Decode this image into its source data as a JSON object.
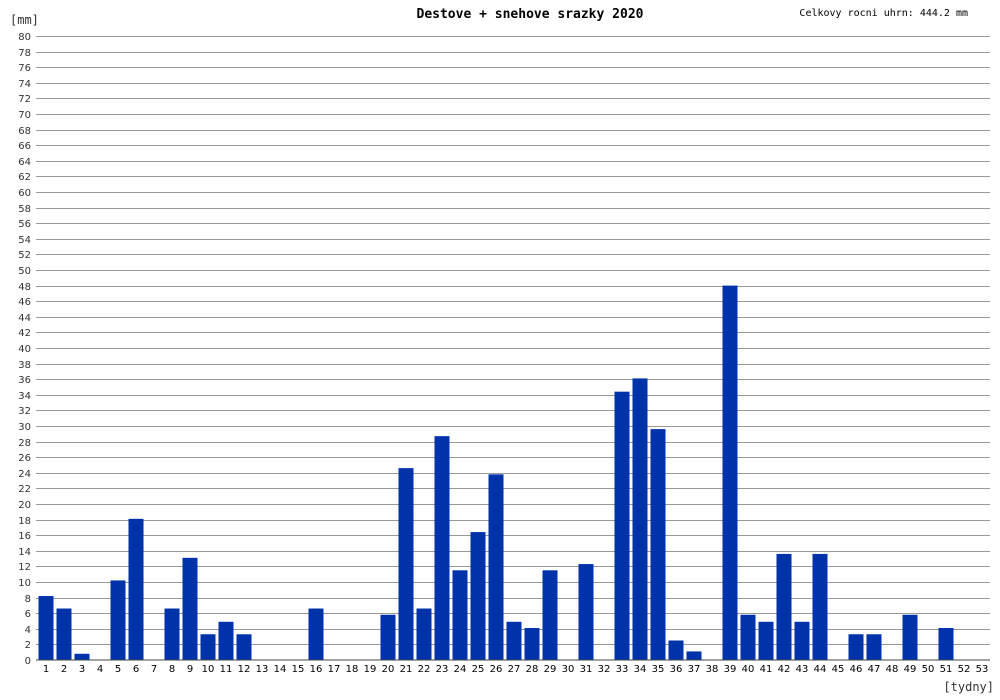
{
  "chart_data": {
    "type": "bar",
    "title": "Destove + snehove srazky 2020",
    "annotation": "Celkovy rocni uhrn: 444.2 mm",
    "ylabel": "[mm]",
    "xlabel": "[tydny]",
    "ylim": [
      0,
      80
    ],
    "ytick_step": 2,
    "grid": true,
    "bar_color": "#0033aa",
    "categories": [
      "1",
      "2",
      "3",
      "4",
      "5",
      "6",
      "7",
      "8",
      "9",
      "10",
      "11",
      "12",
      "13",
      "14",
      "15",
      "16",
      "17",
      "18",
      "19",
      "20",
      "21",
      "22",
      "23",
      "24",
      "25",
      "26",
      "27",
      "28",
      "29",
      "30",
      "31",
      "32",
      "33",
      "34",
      "35",
      "36",
      "37",
      "38",
      "39",
      "40",
      "41",
      "42",
      "43",
      "44",
      "45",
      "46",
      "47",
      "48",
      "49",
      "50",
      "51",
      "52",
      "53"
    ],
    "values": [
      8.2,
      6.6,
      0.8,
      0,
      10.2,
      18.1,
      0,
      6.6,
      13.1,
      3.3,
      4.9,
      3.3,
      0,
      0,
      0,
      6.6,
      0,
      0,
      0,
      5.8,
      24.6,
      6.6,
      28.7,
      11.5,
      16.4,
      23.8,
      4.9,
      4.1,
      11.5,
      0,
      12.3,
      0,
      34.4,
      36.1,
      29.6,
      2.5,
      1.1,
      0,
      48.0,
      5.8,
      4.9,
      13.6,
      4.9,
      13.6,
      0,
      3.3,
      3.3,
      0,
      5.8,
      0,
      4.1,
      0,
      0
    ]
  }
}
